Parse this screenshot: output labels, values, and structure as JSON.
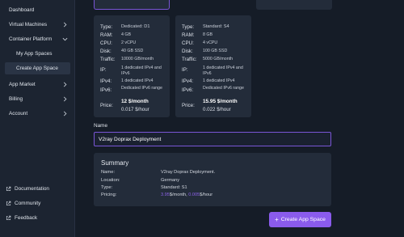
{
  "sidebar": {
    "items": [
      {
        "label": "Dashboard"
      },
      {
        "label": "Virtual Machines"
      },
      {
        "label": "Container Platform"
      },
      {
        "label": "My App Spaces"
      },
      {
        "label": "Create App Space"
      },
      {
        "label": "App Market"
      },
      {
        "label": "Billing"
      },
      {
        "label": "Account"
      }
    ],
    "footer": [
      {
        "label": "Documentation"
      },
      {
        "label": "Community"
      },
      {
        "label": "Feedback"
      }
    ]
  },
  "plans": [
    {
      "type_label": "Type:",
      "type": "Dedicated:  D1",
      "ram_label": "RAM:",
      "ram": "4 GB",
      "cpu_label": "CPU:",
      "cpu": "2 vCPU",
      "disk_label": "Disk:",
      "disk": "40 GB SSD",
      "traffic_label": "Traffic:",
      "traffic": "10000 GB/month",
      "ip_label": "IP:",
      "ip": "1 dedicated IPv4 and IPv6",
      "ipv4_label": "IPv4:",
      "ipv4": "1 dedicated IPv4",
      "ipv6_label": "IPv6:",
      "ipv6": "Dedicated IPv6 range",
      "price_label": "Price:",
      "price_month": "12 $/month",
      "price_hour": "0.017 $/hour"
    },
    {
      "type_label": "Type:",
      "type": "Standard:  S4",
      "ram_label": "RAM:",
      "ram": "8 GB",
      "cpu_label": "CPU:",
      "cpu": "4 vCPU",
      "disk_label": "Disk:",
      "disk": "100 GB SSD",
      "traffic_label": "Traffic:",
      "traffic": "5000 GB/month",
      "ip_label": "IP:",
      "ip": "1 dedicated IPv4 and IPv6",
      "ipv4_label": "IPv4:",
      "ipv4": "1 dedicated IPv4",
      "ipv6_label": "IPv6:",
      "ipv6": "Dedicated IPv6 range",
      "price_label": "Price:",
      "price_month": "15.95 $/month",
      "price_hour": "0.022 $/hour"
    }
  ],
  "name": {
    "label": "Name",
    "value": "V2ray Doprax Deployment"
  },
  "summary": {
    "title": "Summary",
    "name_label": "Name:",
    "name": "V2ray Doprax Deployment.",
    "location_label": "Location:",
    "location": "Germany",
    "type_label": "Type:",
    "type": "Standard:  S1",
    "pricing_label": "Pricing:",
    "pricing_month": "3.95",
    "pricing_month_unit": "$/month,  ",
    "pricing_hour": "0.005",
    "pricing_hour_unit": "$/hour"
  },
  "create_button": {
    "label": "Create App Space"
  },
  "colors": {
    "accent": "#8a5bec",
    "background": "#151c27",
    "card": "#232c3a",
    "sidebar": "#1c2431"
  }
}
